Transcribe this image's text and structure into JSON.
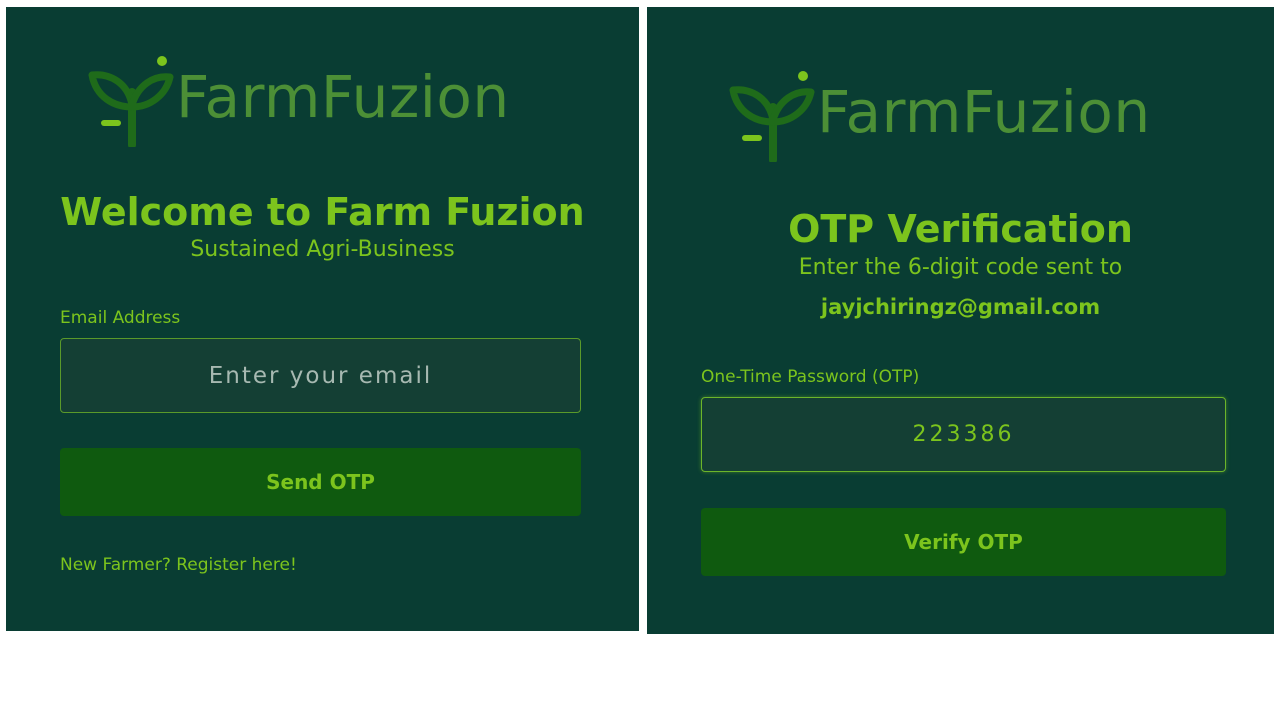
{
  "colors": {
    "panel_bg": "#093d33",
    "accent": "#7cc41d",
    "logo_green": "#4c8f36",
    "button_bg": "#0f5a0f",
    "input_bg": "#143f34"
  },
  "login": {
    "logo_text": "FarmFuzion",
    "title": "Welcome to Farm Fuzion",
    "subtitle": "Sustained Agri-Business",
    "email_label": "Email Address",
    "email_placeholder": "Enter your email",
    "email_value": "",
    "send_button": "Send OTP",
    "register_link": "New Farmer? Register here!"
  },
  "otp": {
    "logo_text": "FarmFuzion",
    "title": "OTP Verification",
    "subtitle": "Enter the 6-digit code sent to",
    "email": "jayjchiringz@gmail.com",
    "otp_label": "One-Time Password (OTP)",
    "otp_value": "223386",
    "verify_button": "Verify OTP"
  }
}
